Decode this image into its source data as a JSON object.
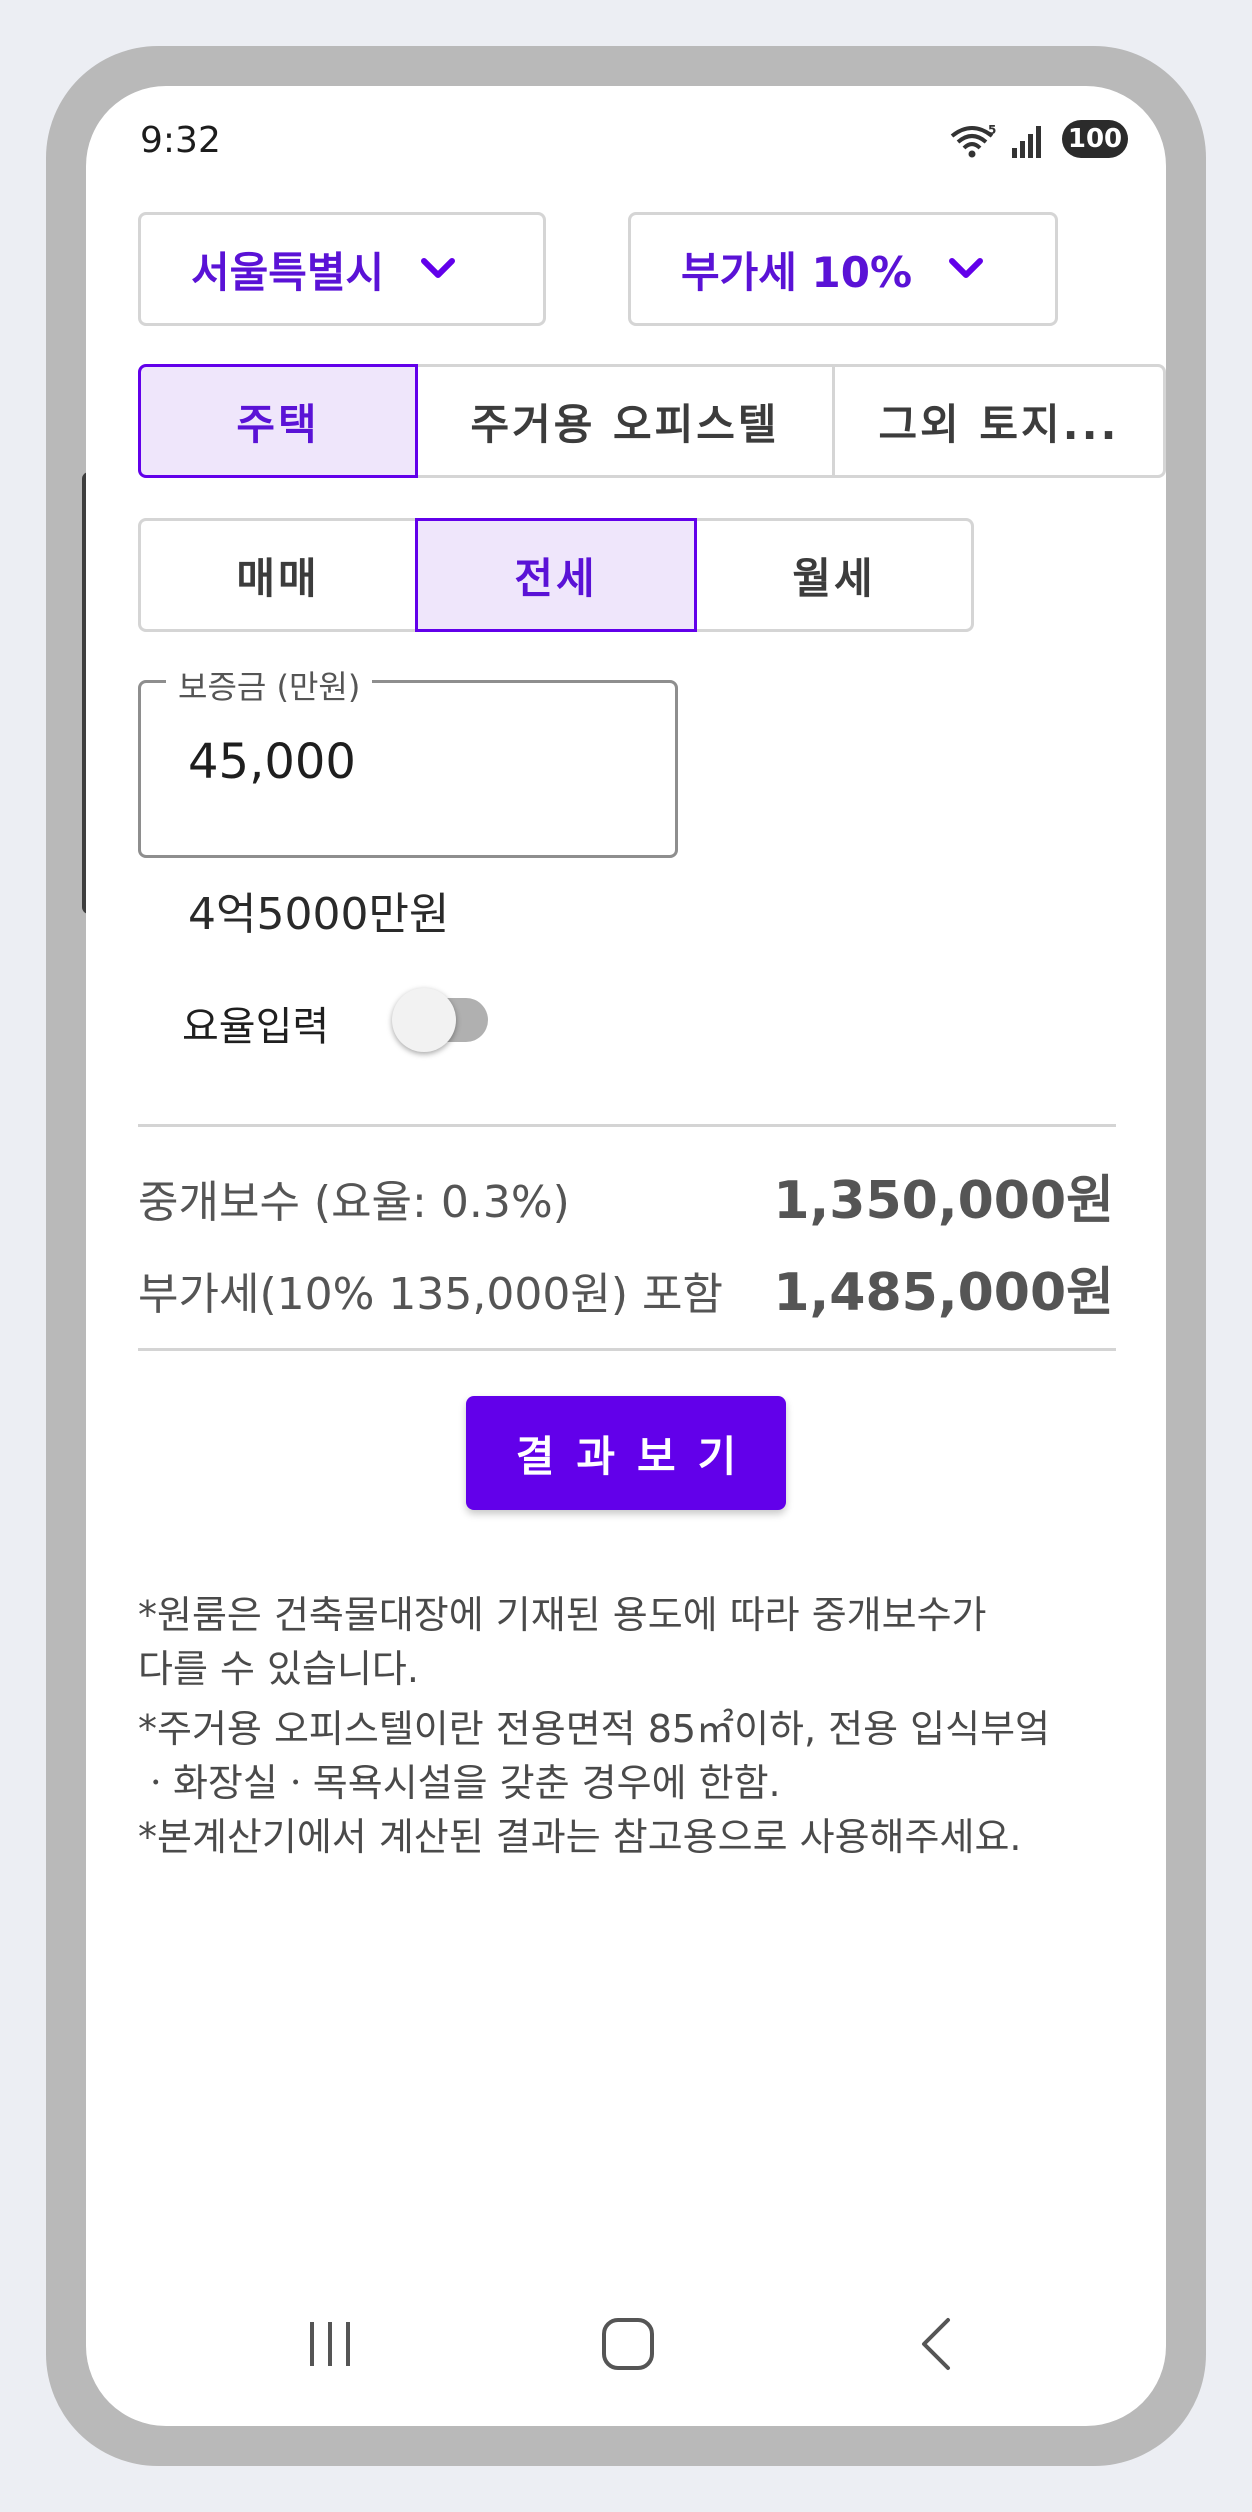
{
  "status_bar": {
    "time": "9:32",
    "battery": "100"
  },
  "region_dropdown": {
    "selected": "서울특별시"
  },
  "vat_dropdown": {
    "selected": "부가세 10%"
  },
  "property_tabs": [
    {
      "label": "주택",
      "selected": true
    },
    {
      "label": "주거용 오피스텔",
      "selected": false
    },
    {
      "label": "그외 토지...",
      "selected": false
    }
  ],
  "deal_tabs": [
    {
      "label": "매매",
      "selected": false
    },
    {
      "label": "전세",
      "selected": true
    },
    {
      "label": "월세",
      "selected": false
    }
  ],
  "deposit_field": {
    "label": "보증금 (만원)",
    "value": "45,000"
  },
  "deposit_text": "4억5000만원",
  "rate_toggle": {
    "label": "요율입력",
    "on": false
  },
  "results": {
    "fee_label": "중개보수 (요율: 0.3%)",
    "fee_value": "1,350,000원",
    "vat_label": "부가세(10% 135,000원) 포함",
    "vat_value": "1,485,000원"
  },
  "result_button_label": "결과보기",
  "notes": [
    "*원룸은 건축물대장에 기재된 용도에 따라 중개보수가",
    "다를 수 있습니다.",
    "*주거용 오피스텔이란 전용면적 85㎡이하, 전용 입식부엌",
    "ㆍ화장실ㆍ목욕시설을 갖춘 경우에 한함.",
    "*본계산기에서 계산된 결과는 참고용으로 사용해주세요."
  ],
  "colors": {
    "accent": "#6200ea",
    "selected_bg": "#efe6fb",
    "text_gray": "#555555"
  },
  "nav_bar": {
    "icons": [
      "recent-apps-icon",
      "home-icon",
      "back-icon"
    ]
  }
}
